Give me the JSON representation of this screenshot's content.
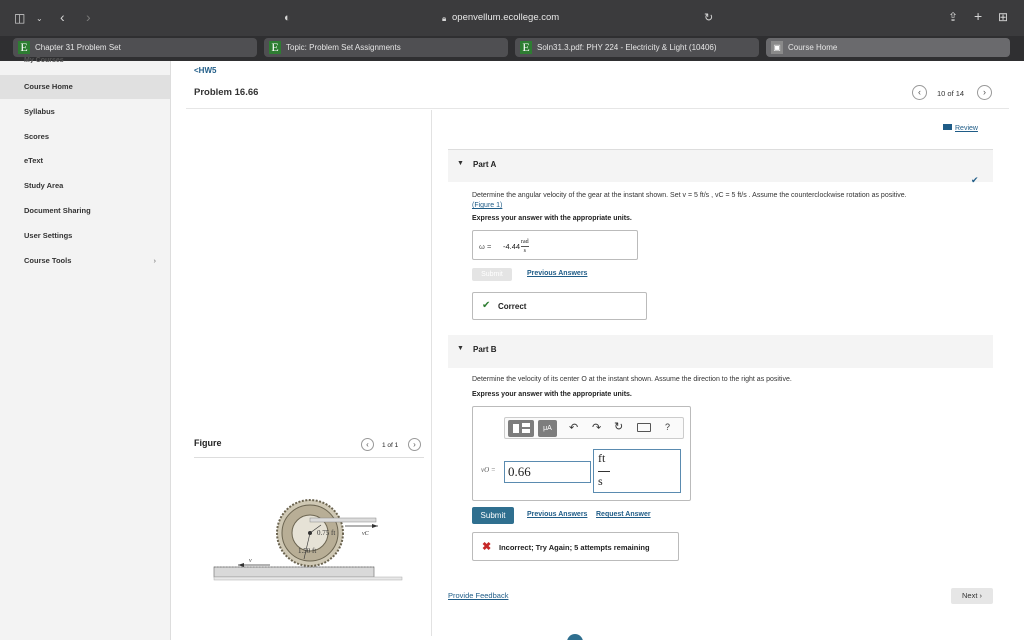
{
  "browser": {
    "url": "openvellum.ecollege.com",
    "tabs": [
      {
        "label": "Chapter 31 Problem Set"
      },
      {
        "label": "Topic: Problem Set Assignments"
      },
      {
        "label": "Soln31.3.pdf: PHY 224 - Electricity & Light (10406)"
      },
      {
        "label": "Course Home"
      }
    ]
  },
  "sidebar": {
    "top_clipped": "My Courses",
    "items": [
      {
        "label": "Course Home"
      },
      {
        "label": "Syllabus"
      },
      {
        "label": "Scores"
      },
      {
        "label": "eText"
      },
      {
        "label": "Study Area"
      },
      {
        "label": "Document Sharing"
      },
      {
        "label": "User Settings"
      },
      {
        "label": "Course Tools"
      }
    ]
  },
  "header": {
    "back": "<HW5",
    "title": "Problem 16.66",
    "pager": "10 of 14"
  },
  "review": "Review",
  "figure": {
    "title": "Figure",
    "pager": "1 of 1",
    "labels": {
      "radius_small": "0.75 ft",
      "radius_large": "1.50 ft",
      "v": "v",
      "vc": "vC"
    }
  },
  "partA": {
    "title": "Part A",
    "question": "Determine the angular velocity of the gear at the instant shown. Set v = 5 ft/s , vC = 5 ft/s . Assume the counterclockwise rotation as positive.",
    "figure_link": "(Figure 1)",
    "instruction": "Express your answer with the appropriate units.",
    "answer_label": "ω =",
    "answer_value": "-4.44",
    "unit_num": "rad",
    "unit_den": "s",
    "submit": "Submit",
    "previous": "Previous Answers",
    "result": "Correct"
  },
  "partB": {
    "title": "Part B",
    "question": "Determine the velocity of its center O at the instant shown. Assume the direction to the right as positive.",
    "instruction": "Express your answer with the appropriate units.",
    "answer_label": "vO =",
    "answer_value": "0.66",
    "unit_num": "ft",
    "unit_den": "s",
    "submit": "Submit",
    "previous": "Previous Answers",
    "request": "Request Answer",
    "result": "Incorrect; Try Again; 5 attempts remaining",
    "toolbar_help": "?",
    "toolbar_mu": "μA"
  },
  "footer": {
    "feedback": "Provide Feedback",
    "next": "Next"
  },
  "colors": {
    "correct": "#2e7d32",
    "incorrect": "#c62828",
    "link": "#1f5c87",
    "submit": "#2f6f8f"
  }
}
